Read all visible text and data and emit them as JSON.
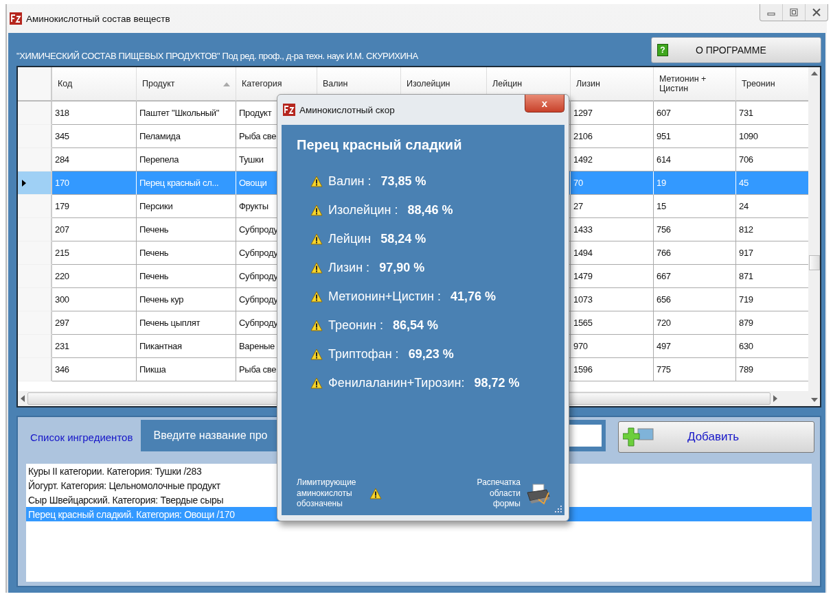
{
  "window": {
    "title": "Аминокислотный состав веществ"
  },
  "header": {
    "text": "\"ХИМИЧЕСКИЙ СОСТАВ ПИЩЕВЫХ ПРОДУКТОВ\" Под ред. проф., д-ра техн. наук И.М. СКУРИХИНА"
  },
  "about_button": {
    "icon_text": "?",
    "label": "О ПРОГРАММЕ"
  },
  "table": {
    "columns": [
      {
        "label": "Код",
        "sorted": false
      },
      {
        "label": "Продукт",
        "sorted": true
      },
      {
        "label": "Категория",
        "sorted": false
      },
      {
        "label": "Валин",
        "sorted": false
      },
      {
        "label": "Изолейцин",
        "sorted": false
      },
      {
        "label": "Лейцин",
        "sorted": false
      },
      {
        "label": "Лизин",
        "sorted": false
      },
      {
        "label": "Метионин + Цистин",
        "sorted": false
      },
      {
        "label": "Треонин",
        "sorted": false
      }
    ],
    "rows": [
      {
        "selected": false,
        "cells": [
          "318",
          "Паштет \"Школьный\"",
          "Продукт",
          "1297",
          "607",
          "731"
        ]
      },
      {
        "selected": false,
        "cells": [
          "345",
          "Пеламида",
          "Рыба све",
          "2106",
          "951",
          "1090"
        ]
      },
      {
        "selected": false,
        "cells": [
          "284",
          "Перепела",
          "Тушки",
          "1492",
          "614",
          "706"
        ]
      },
      {
        "selected": true,
        "cells": [
          "170",
          "Перец красный сл...",
          "Овощи",
          "70",
          "19",
          "45"
        ]
      },
      {
        "selected": false,
        "cells": [
          "179",
          "Персики",
          "Фрукты",
          "27",
          "15",
          "24"
        ]
      },
      {
        "selected": false,
        "cells": [
          "207",
          "Печень",
          "Субпроду",
          "1433",
          "756",
          "812"
        ]
      },
      {
        "selected": false,
        "cells": [
          "215",
          "Печень",
          "Субпроду",
          "1494",
          "766",
          "917"
        ]
      },
      {
        "selected": false,
        "cells": [
          "220",
          "Печень",
          "Субпроду",
          "1479",
          "667",
          "871"
        ]
      },
      {
        "selected": false,
        "cells": [
          "300",
          "Печень кур",
          "Субпроду",
          "1073",
          "656",
          "719"
        ]
      },
      {
        "selected": false,
        "cells": [
          "297",
          "Печень цыплят",
          "Субпроду",
          "1565",
          "720",
          "879"
        ]
      },
      {
        "selected": false,
        "cells": [
          "231",
          "Пикантная",
          "Вареные",
          "970",
          "497",
          "630"
        ]
      },
      {
        "selected": false,
        "cells": [
          "346",
          "Пикша",
          "Рыба све",
          "1596",
          "775",
          "789"
        ]
      }
    ]
  },
  "bottom": {
    "tab": {
      "label": "Список ингредиентов",
      "selected": true
    },
    "search_label": "Введите название про",
    "add_button": "Добавить",
    "ingredients": [
      {
        "text": "Куры II категории. Категория: Тушки /283",
        "selected": false
      },
      {
        "text": "Йогурт. Категория: Цельномолочные продукт",
        "selected": false
      },
      {
        "text": "Сыр Швейцарский. Категория: Твердые сыры",
        "selected": false
      },
      {
        "text": "Перец красный сладкий. Категория: Овощи /170",
        "selected": true
      }
    ]
  },
  "dialog": {
    "title": "Аминокислотный скор",
    "close": "x",
    "product": "Перец красный сладкий",
    "scores": [
      {
        "name": "Валин :",
        "value": "73,85 %",
        "limiting": true
      },
      {
        "name": "Изолейцин :",
        "value": "88,46 %",
        "limiting": true
      },
      {
        "name": "Лейцин",
        "value": "58,24 %",
        "limiting": true
      },
      {
        "name": "Лизин :",
        "value": "97,90 %",
        "limiting": true
      },
      {
        "name": "Метионин+Цистин :",
        "value": "41,76 %",
        "limiting": true
      },
      {
        "name": "Треонин :",
        "value": "86,54 %",
        "limiting": true
      },
      {
        "name": "Триптофан :",
        "value": "69,23 %",
        "limiting": true
      },
      {
        "name": "Фенилаланин+Тирозин:",
        "value": "98,72 %",
        "limiting": true
      }
    ],
    "legend": "Лимитирующие аминокислоты обозначены",
    "print_label": "Распечатка области формы"
  }
}
